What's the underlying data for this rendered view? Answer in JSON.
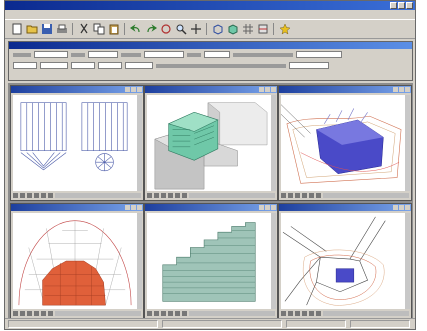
{
  "window": {
    "title": "",
    "menu": [
      "",
      "",
      "",
      "",
      "",
      "",
      "",
      "",
      ""
    ]
  },
  "toolbar": {
    "icons": [
      "new-icon",
      "open-icon",
      "save-icon",
      "print-icon",
      "cut-icon",
      "copy-icon",
      "paste-icon",
      "undo-icon",
      "redo-icon",
      "rotate-icon",
      "zoom-icon",
      "pan-icon",
      "wireframe-icon",
      "shade-icon",
      "grid-icon",
      "section-icon",
      "help-icon"
    ]
  },
  "panels": [
    {
      "id": "elevation-view",
      "title": ""
    },
    {
      "id": "3d-massing-view",
      "title": ""
    },
    {
      "id": "site-view",
      "title": ""
    },
    {
      "id": "sun-dome-view",
      "title": ""
    },
    {
      "id": "facade-view",
      "title": ""
    },
    {
      "id": "plan-view",
      "title": ""
    }
  ],
  "colors": {
    "title_dark": "#0b2a8f",
    "title_light": "#3a6fd8",
    "chrome": "#d4d0c8",
    "mdi_bg": "#8c8c8c",
    "massing_green": "#6fc8a8",
    "massing_gray": "#cfcfcf",
    "shadow_red": "#e0603a",
    "solid_blue": "#4a4ac8",
    "facade_green": "#9fc4b8"
  }
}
